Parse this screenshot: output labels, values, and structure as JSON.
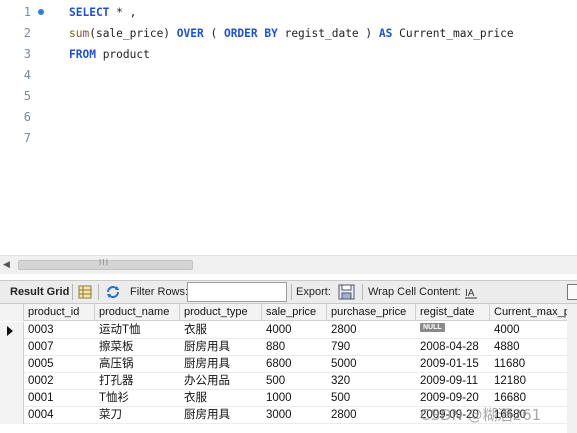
{
  "editor": {
    "lines": [
      {
        "num": "1",
        "breakpoint": true,
        "tokens": [
          {
            "t": "SELECT",
            "c": "kw"
          },
          {
            "t": " * ,",
            "c": ""
          }
        ]
      },
      {
        "num": "2",
        "breakpoint": false,
        "tokens": [
          {
            "t": "sum",
            "c": "fn"
          },
          {
            "t": "(sale_price) ",
            "c": ""
          },
          {
            "t": "OVER",
            "c": "kw"
          },
          {
            "t": " ( ",
            "c": ""
          },
          {
            "t": "ORDER BY",
            "c": "kw"
          },
          {
            "t": " regist_date ) ",
            "c": ""
          },
          {
            "t": "AS",
            "c": "kw"
          },
          {
            "t": " Current_max_price",
            "c": ""
          }
        ]
      },
      {
        "num": "3",
        "breakpoint": false,
        "tokens": [
          {
            "t": "FROM",
            "c": "kw"
          },
          {
            "t": " product",
            "c": ""
          }
        ]
      },
      {
        "num": "4",
        "breakpoint": false,
        "tokens": []
      },
      {
        "num": "5",
        "breakpoint": false,
        "tokens": []
      },
      {
        "num": "6",
        "breakpoint": false,
        "tokens": []
      },
      {
        "num": "7",
        "breakpoint": false,
        "tokens": []
      }
    ],
    "scroll_grip": "III"
  },
  "toolbar": {
    "result_grid": "Result Grid",
    "filter_rows": "Filter Rows:",
    "filter_value": "",
    "export": "Export:",
    "wrap": "Wrap Cell Content:"
  },
  "grid": {
    "columns": [
      "product_id",
      "product_name",
      "product_type",
      "sale_price",
      "purchase_price",
      "regist_date",
      "Current_max_pr"
    ],
    "null_label": "NULL",
    "rows": [
      [
        "0003",
        "运动T恤",
        "衣服",
        "4000",
        "2800",
        null,
        "4000"
      ],
      [
        "0007",
        "擦菜板",
        "厨房用具",
        "880",
        "790",
        "2008-04-28",
        "4880"
      ],
      [
        "0005",
        "高压锅",
        "厨房用具",
        "6800",
        "5000",
        "2009-01-15",
        "11680"
      ],
      [
        "0002",
        "打孔器",
        "办公用品",
        "500",
        "320",
        "2009-09-11",
        "12180"
      ],
      [
        "0001",
        "T恤衫",
        "衣服",
        "1000",
        "500",
        "2009-09-20",
        "16680"
      ],
      [
        "0004",
        "菜刀",
        "厨房用具",
        "3000",
        "2800",
        "2009-09-20",
        "16680"
      ]
    ]
  },
  "watermark": "CSDN @糊酒261",
  "colors": {
    "keyword": "#1f52c9",
    "function": "#7d5b1f",
    "line_number": "#7a8aa0",
    "breakpoint": "#2e7dd7"
  }
}
